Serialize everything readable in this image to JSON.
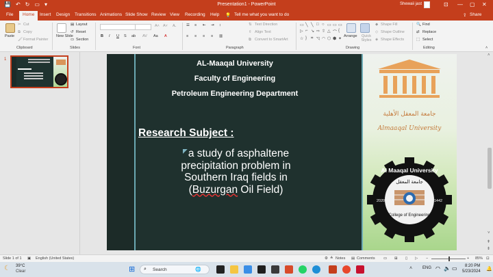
{
  "window": {
    "title": "Presentation1 - PowerPoint",
    "user_name": "Shewaii jast",
    "controls": [
      "—",
      "▢",
      "✕"
    ]
  },
  "tabs": [
    "File",
    "Home",
    "Insert",
    "Design",
    "Transitions",
    "Animations",
    "Slide Show",
    "Review",
    "View",
    "Recording",
    "Help"
  ],
  "active_tab": "Home",
  "tell_me": "Tell me what you want to do",
  "share_label": "Share",
  "ribbon": {
    "clipboard": {
      "paste": "Paste",
      "cut": "Cut",
      "copy": "Copy",
      "format_painter": "Format Painter",
      "label": "Clipboard"
    },
    "slides": {
      "new_slide": "New Slide",
      "layout": "Layout",
      "reset": "Reset",
      "section": "Section",
      "label": "Slides"
    },
    "font": {
      "bold": "B",
      "italic": "I",
      "underline": "U",
      "strike": "S",
      "shadow": "ab",
      "label": "Font"
    },
    "paragraph": {
      "text_direction": "Text Direction",
      "align_text": "Align Text",
      "smartart": "Convert to SmartArt",
      "label": "Paragraph"
    },
    "drawing": {
      "arrange": "Arrange",
      "quick_styles": "Quick Styles",
      "shape_fill": "Shape Fill",
      "shape_outline": "Shape Outline",
      "shape_effects": "Shape Effects",
      "label": "Drawing"
    },
    "editing": {
      "find": "Find",
      "replace": "Replace",
      "select": "Select",
      "label": "Editing"
    }
  },
  "thumbnail": {
    "number": "1"
  },
  "slide": {
    "university": "AL-Maaqal University",
    "faculty": "Faculty of Engineering",
    "department": "Petroleum Engineering Department",
    "research_heading": "Research Subject :",
    "body_line1": "a study of asphaltene",
    "body_line2": "precipitation problem in",
    "body_line3": "Southern Iraq fields in",
    "body_line4_pre": "(",
    "body_line4_spell": "Buzurgan",
    "body_line4_post": " Oil Field)",
    "logo_top_arabic": "جامعة المعقل الأهلية",
    "logo_top_latin": "Almaaqal University",
    "seal_top": "Al Maaqal University",
    "seal_arabic": "جامعة المعقل",
    "seal_bottom": "College of Engineering",
    "seal_year_left": "2020",
    "seal_year_right": "1442"
  },
  "status": {
    "slide_of": "Slide 1 of 1",
    "language": "English (United States)",
    "notes": "Notes",
    "comments": "Comments",
    "zoom": "85%"
  },
  "taskbar": {
    "temperature": "39°C",
    "weather": "Clear",
    "search": "Search",
    "lang": "ENG",
    "time": "8:20 PM",
    "date": "5/23/2024"
  },
  "colors": {
    "accent": "#c43e1c",
    "slide_bg": "#1f312e",
    "rule": "#6ba9b3"
  }
}
